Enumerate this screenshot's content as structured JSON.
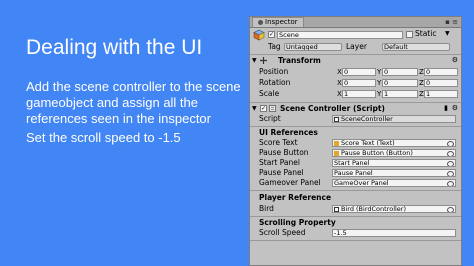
{
  "slide": {
    "title": "Dealing with the UI",
    "paragraph1": "Add the scene controller to the scene gameobject and assign all the references seen in the inspector",
    "paragraph2": "Set the scroll speed to -1.5",
    "background_color": "#4285f4"
  },
  "inspector": {
    "tab_label": "Inspector",
    "tab_actions": "▪ ≡",
    "object": {
      "name": "Scene",
      "static_label": "Static",
      "tag_label": "Tag",
      "tag_value": "Untagged",
      "layer_label": "Layer",
      "layer_value": "Default"
    },
    "transform": {
      "title": "Transform",
      "position_label": "Position",
      "rotation_label": "Rotation",
      "scale_label": "Scale",
      "axis_x": "X",
      "axis_y": "Y",
      "axis_z": "Z",
      "position": [
        "0",
        "0",
        "0"
      ],
      "rotation": [
        "0",
        "0",
        "0"
      ],
      "scale": [
        "1",
        "1",
        "1"
      ]
    },
    "component": {
      "title": "Scene Controller (Script)",
      "script_label": "Script",
      "script_value": "SceneController",
      "ui_refs_header": "UI References",
      "score_text_label": "Score Text",
      "score_text_value": "Score Text (Text)",
      "pause_button_label": "Pause Button",
      "pause_button_value": "Pause Button (Button)",
      "start_panel_label": "Start Panel",
      "start_panel_value": "Start Panel",
      "pause_panel_label": "Pause Panel",
      "pause_panel_value": "Pause Panel",
      "gameover_panel_label": "Gameover Panel",
      "gameover_panel_value": "GameOver Panel",
      "player_ref_header": "Player Reference",
      "bird_label": "Bird",
      "bird_value": "Bird (BirdController)",
      "scroll_header": "Scrolling Property",
      "scroll_speed_label": "Scroll Speed",
      "scroll_speed_value": "-1.5"
    }
  }
}
